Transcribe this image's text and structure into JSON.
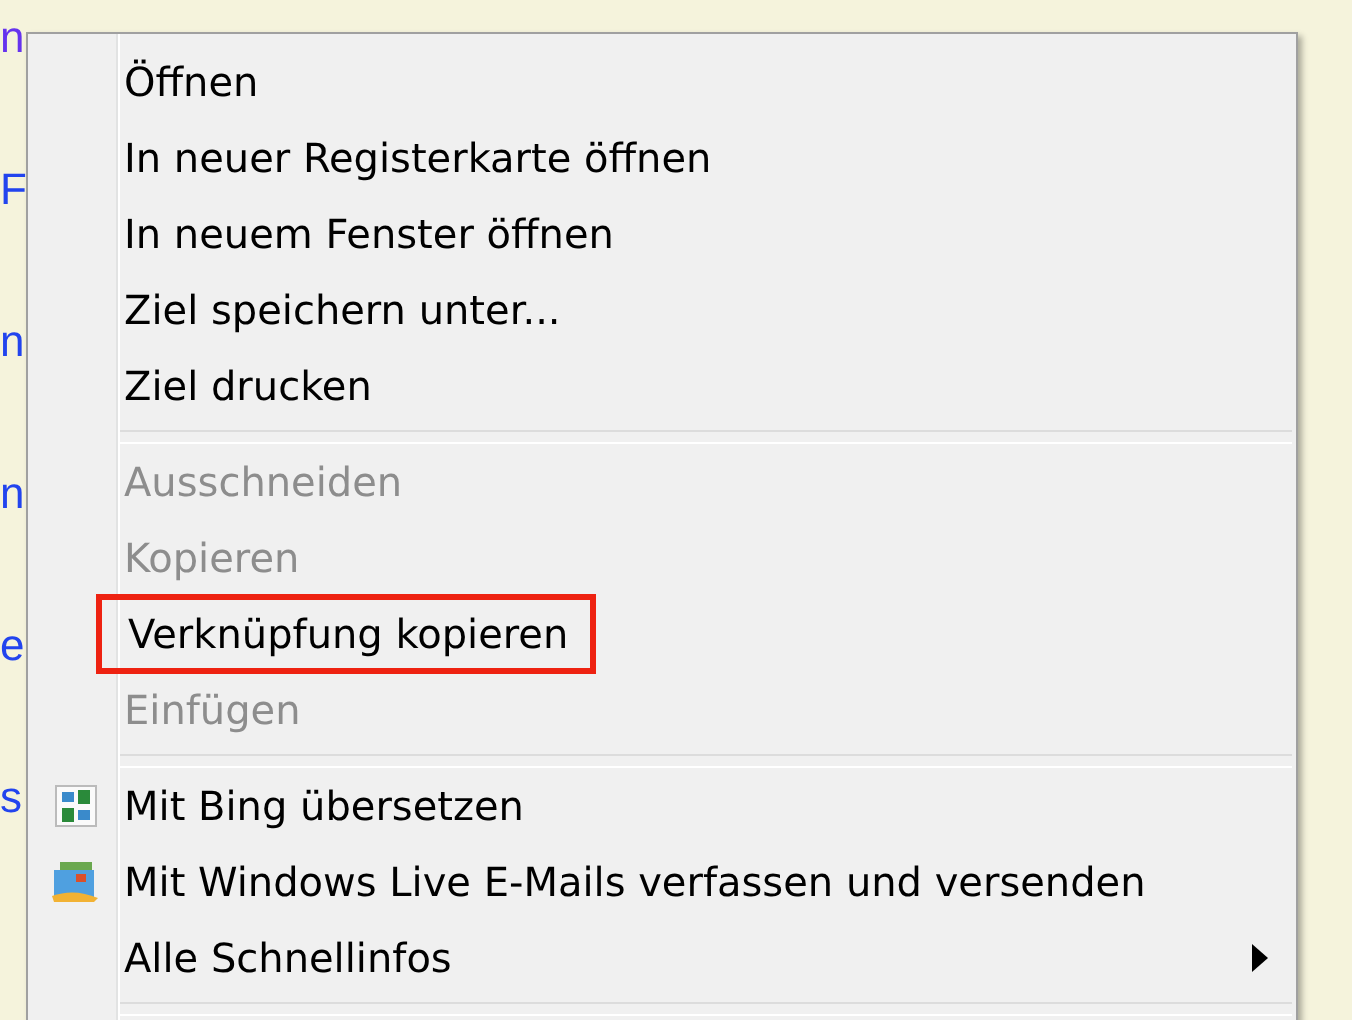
{
  "background_fragments": [
    {
      "text": "n",
      "color": "#6633ee"
    },
    {
      "text": "F",
      "color": "#2244ee"
    },
    {
      "text": "n",
      "color": "#2244ee"
    },
    {
      "text": "n",
      "color": "#2244ee"
    },
    {
      "text": "e",
      "color": "#2244ee"
    },
    {
      "text": "s",
      "color": "#2244ee"
    }
  ],
  "menu": {
    "items": [
      {
        "kind": "item",
        "label": "Öffnen",
        "disabled": false
      },
      {
        "kind": "item",
        "label": "In neuer Registerkarte öffnen",
        "disabled": false
      },
      {
        "kind": "item",
        "label": "In neuem Fenster öffnen",
        "disabled": false
      },
      {
        "kind": "item",
        "label": "Ziel speichern unter...",
        "disabled": false
      },
      {
        "kind": "item",
        "label": "Ziel drucken",
        "disabled": false
      },
      {
        "kind": "separator"
      },
      {
        "kind": "item",
        "label": "Ausschneiden",
        "disabled": true
      },
      {
        "kind": "item",
        "label": "Kopieren",
        "disabled": true
      },
      {
        "kind": "item",
        "label": "Verknüpfung kopieren",
        "disabled": false,
        "outlined": true
      },
      {
        "kind": "item",
        "label": "Einfügen",
        "disabled": true
      },
      {
        "kind": "separator"
      },
      {
        "kind": "translate",
        "label": "Mit Bing übersetzen",
        "disabled": false
      },
      {
        "kind": "mail",
        "label": "Mit Windows Live E-Mails verfassen und versenden",
        "disabled": false
      },
      {
        "kind": "item",
        "label": "Alle Schnellinfos",
        "disabled": false,
        "submenu": true
      },
      {
        "kind": "separator"
      }
    ]
  }
}
